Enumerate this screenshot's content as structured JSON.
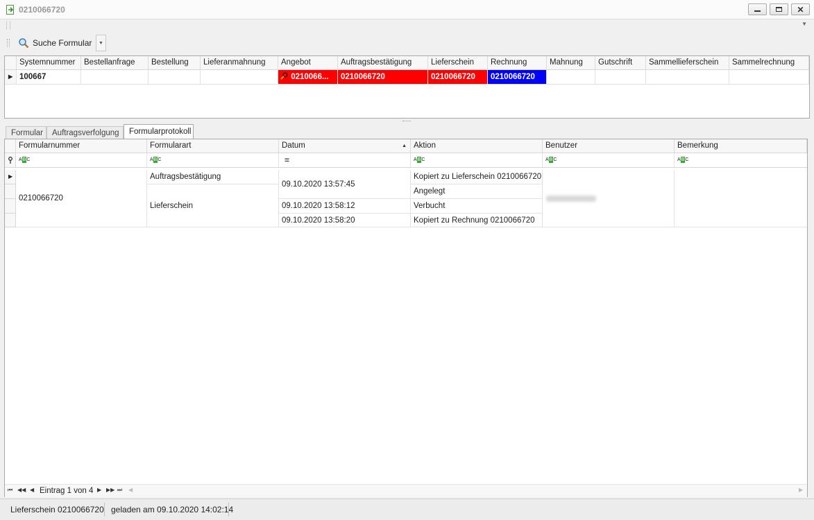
{
  "window": {
    "title": "0210066720"
  },
  "toolbar": {
    "search_label": "Suche Formular"
  },
  "top_grid": {
    "columns": [
      "Systemnummer",
      "Bestellanfrage",
      "Bestellung",
      "Lieferanmahnung",
      "Angebot",
      "Auftragsbestätigung",
      "Lieferschein",
      "Rechnung",
      "Mahnung",
      "Gutschrift",
      "Sammellieferschein",
      "Sammelrechnung"
    ],
    "row": {
      "systemnummer": "100667",
      "angebot": "0210066...",
      "auftragsbestaetigung": "0210066720",
      "lieferschein": "0210066720",
      "rechnung": "0210066720"
    },
    "colors": {
      "red": "#ff0000",
      "blue": "#0000ff"
    }
  },
  "tabs": [
    "Formular",
    "Auftragsverfolgung",
    "Formularprotokoll"
  ],
  "main_grid": {
    "columns": [
      "Formularnummer",
      "Formularart",
      "Datum",
      "Aktion",
      "Benutzer",
      "Bemerkung"
    ],
    "formularnummer": "0210066720",
    "formularart": [
      "Auftragsbestätigung",
      "Lieferschein"
    ],
    "datum": [
      "09.10.2020 13:57:45",
      "09.10.2020 13:58:12",
      "09.10.2020 13:58:20"
    ],
    "aktion": [
      "Kopiert zu Lieferschein  0210066720",
      "Angelegt",
      "Verbucht",
      "Kopiert zu Rechnung  0210066720"
    ],
    "filter_equals": "="
  },
  "pager": {
    "entry_text": "Eintrag 1 von 4"
  },
  "status": {
    "left": "Lieferschein 0210066720",
    "right": "geladen am 09.10.2020 14:02:14"
  }
}
